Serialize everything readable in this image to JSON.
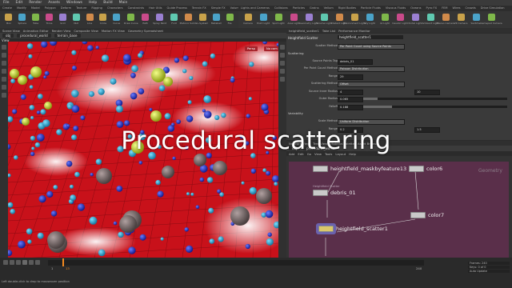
{
  "menu": [
    "File",
    "Edit",
    "Render",
    "Assets",
    "Windows",
    "Help",
    "Build",
    "Main"
  ],
  "shelf_left": {
    "tabs": [
      "Create",
      "Modify",
      "Model",
      "Polygon",
      "Deform",
      "Texture",
      "Rigging",
      "Characters",
      "Constraints",
      "Hair Utils",
      "Guide Process",
      "Terrain FX",
      "Simple FX",
      "Volume"
    ],
    "tools": [
      "Box",
      "Sphere",
      "Tube",
      "Torus",
      "Grid",
      "Null",
      "Line",
      "Circle",
      "Curve",
      "Draw Curve",
      "Path",
      "Spray Paint",
      "Font",
      "Platonic Solids",
      "L-System",
      "Metaball",
      "File"
    ]
  },
  "shelf_right": {
    "tabs": [
      "Lights and Cameras",
      "Collisions",
      "Particles",
      "Grains",
      "Vellum",
      "Rigid Bodies",
      "Particle Fluids",
      "Viscous Fluids",
      "Oceans",
      "Pyro FX",
      "FEM",
      "Wires",
      "Crowds",
      "Drive Simulation"
    ],
    "tools": [
      "Camera",
      "Point Light",
      "Spot Light",
      "Area Light",
      "Geometry Light",
      "Volume Light",
      "Distant Light",
      "Environment Light",
      "Sky Light",
      "GI Light",
      "Caustic Light",
      "Portal Light",
      "Ambient Light",
      "Stereo Camera",
      "VR Camera",
      "Switcher",
      "Gamepad Camera"
    ]
  },
  "viewport_tabs": [
    "Scene View",
    "Animation Editor",
    "Render View",
    "Composite View",
    "Motion FX View",
    "Geometry Spreadsheet"
  ],
  "viewport_path": {
    "obj": "obj",
    "node": "procedural_world",
    "sub": "terrain_base"
  },
  "viewport_label": "View",
  "viewport_badges": {
    "persp": "Persp",
    "cam": "No cam"
  },
  "overlay_title": "Procedural scattering",
  "params_tabs": [
    "heightfield_scatter1",
    "Take List",
    "Performance Monitor"
  ],
  "params_header": {
    "type": "Heightfield Scatter",
    "name": "heightfield_scatter1"
  },
  "params_rows": [
    {
      "label": "Scatter Method",
      "value": "Per Point Count using Source Points",
      "kind": "menu"
    },
    {
      "section": "Scattering"
    },
    {
      "label": "Source Points Tag",
      "value": "debris_01",
      "kind": "text"
    },
    {
      "label": "Per Point Count Method",
      "value": "Poisson Distribution",
      "kind": "menu"
    },
    {
      "label": "Range",
      "value": "29",
      "kind": "num"
    },
    {
      "label": "Scattering Method",
      "value": "Offset",
      "kind": "menu"
    },
    {
      "label": "Source Inner Radius",
      "value": "4",
      "kind": "num",
      "value2": "10"
    },
    {
      "label": "Outer Radius",
      "value": "0.065",
      "kind": "slider",
      "fill": 0.1
    },
    {
      "label": "Falloff",
      "value": "0.188",
      "kind": "slider",
      "fill": 0.2
    },
    {
      "section": "Variability"
    },
    {
      "label": "Scale Method",
      "value": "Uniform Distribution",
      "kind": "menu"
    },
    {
      "label": "Range",
      "value": "0.2",
      "kind": "num",
      "value2": "1.5"
    }
  ],
  "network_tabs": [
    "Network View",
    "Tree View",
    "Material Palette",
    "Asset Browser"
  ],
  "network_path": {
    "obj": "obj",
    "node": "procedural_world"
  },
  "network_menu": [
    "Add",
    "Edit",
    "Go",
    "View",
    "Tools",
    "Layout",
    "Help"
  ],
  "network_context_label": "Geometry",
  "nodes": [
    {
      "name": "heightfield_maskbyfeature13",
      "sub": "",
      "color": "#c9c9c9"
    },
    {
      "name": "color6",
      "sub": "",
      "color": "#c9c9c9"
    },
    {
      "name": "debris_01",
      "sub": "Heightfield Scatter",
      "color": "#c9c9c9"
    },
    {
      "name": "color7",
      "sub": "",
      "color": "#c9c9c9"
    },
    {
      "name": "heightfield_scatter1",
      "sub": "",
      "color": "#d9c86a"
    }
  ],
  "timeline": {
    "start_frame": "1",
    "current_frame": "13",
    "end_frame": "240"
  },
  "right_status": [
    "Frames: 240",
    "Keys: 0 of 0",
    "Auto Update"
  ],
  "status_text": "Left double-click to drop to mouseover position",
  "colors": {
    "viewport_red": "#c8111a",
    "network_bg": "#5a2f4a",
    "playhead": "#f58a1f"
  }
}
